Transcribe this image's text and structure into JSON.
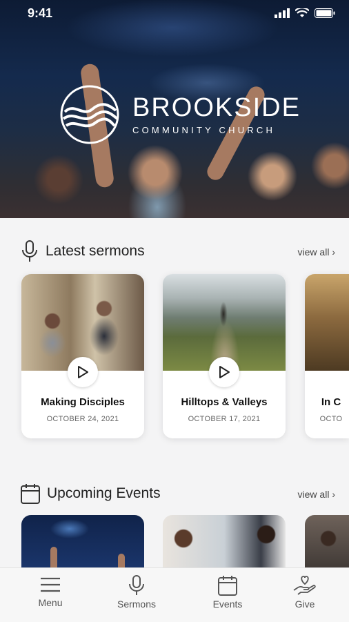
{
  "status_bar": {
    "time": "9:41"
  },
  "hero": {
    "brand_name": "BROOKSIDE",
    "brand_sub": "COMMUNITY CHURCH"
  },
  "sermons": {
    "title": "Latest sermons",
    "view_all": "view all ›",
    "items": [
      {
        "title": "Making Disciples",
        "date": "OCTOBER 24, 2021"
      },
      {
        "title": "Hilltops & Valleys",
        "date": "OCTOBER 17, 2021"
      },
      {
        "title": "In C",
        "date": "OCTO"
      }
    ]
  },
  "events": {
    "title": "Upcoming Events",
    "view_all": "view all ›"
  },
  "tabs": [
    {
      "label": "Menu",
      "icon": "menu-icon"
    },
    {
      "label": "Sermons",
      "icon": "microphone-icon"
    },
    {
      "label": "Events",
      "icon": "calendar-icon"
    },
    {
      "label": "Give",
      "icon": "give-hand-heart-icon"
    }
  ]
}
